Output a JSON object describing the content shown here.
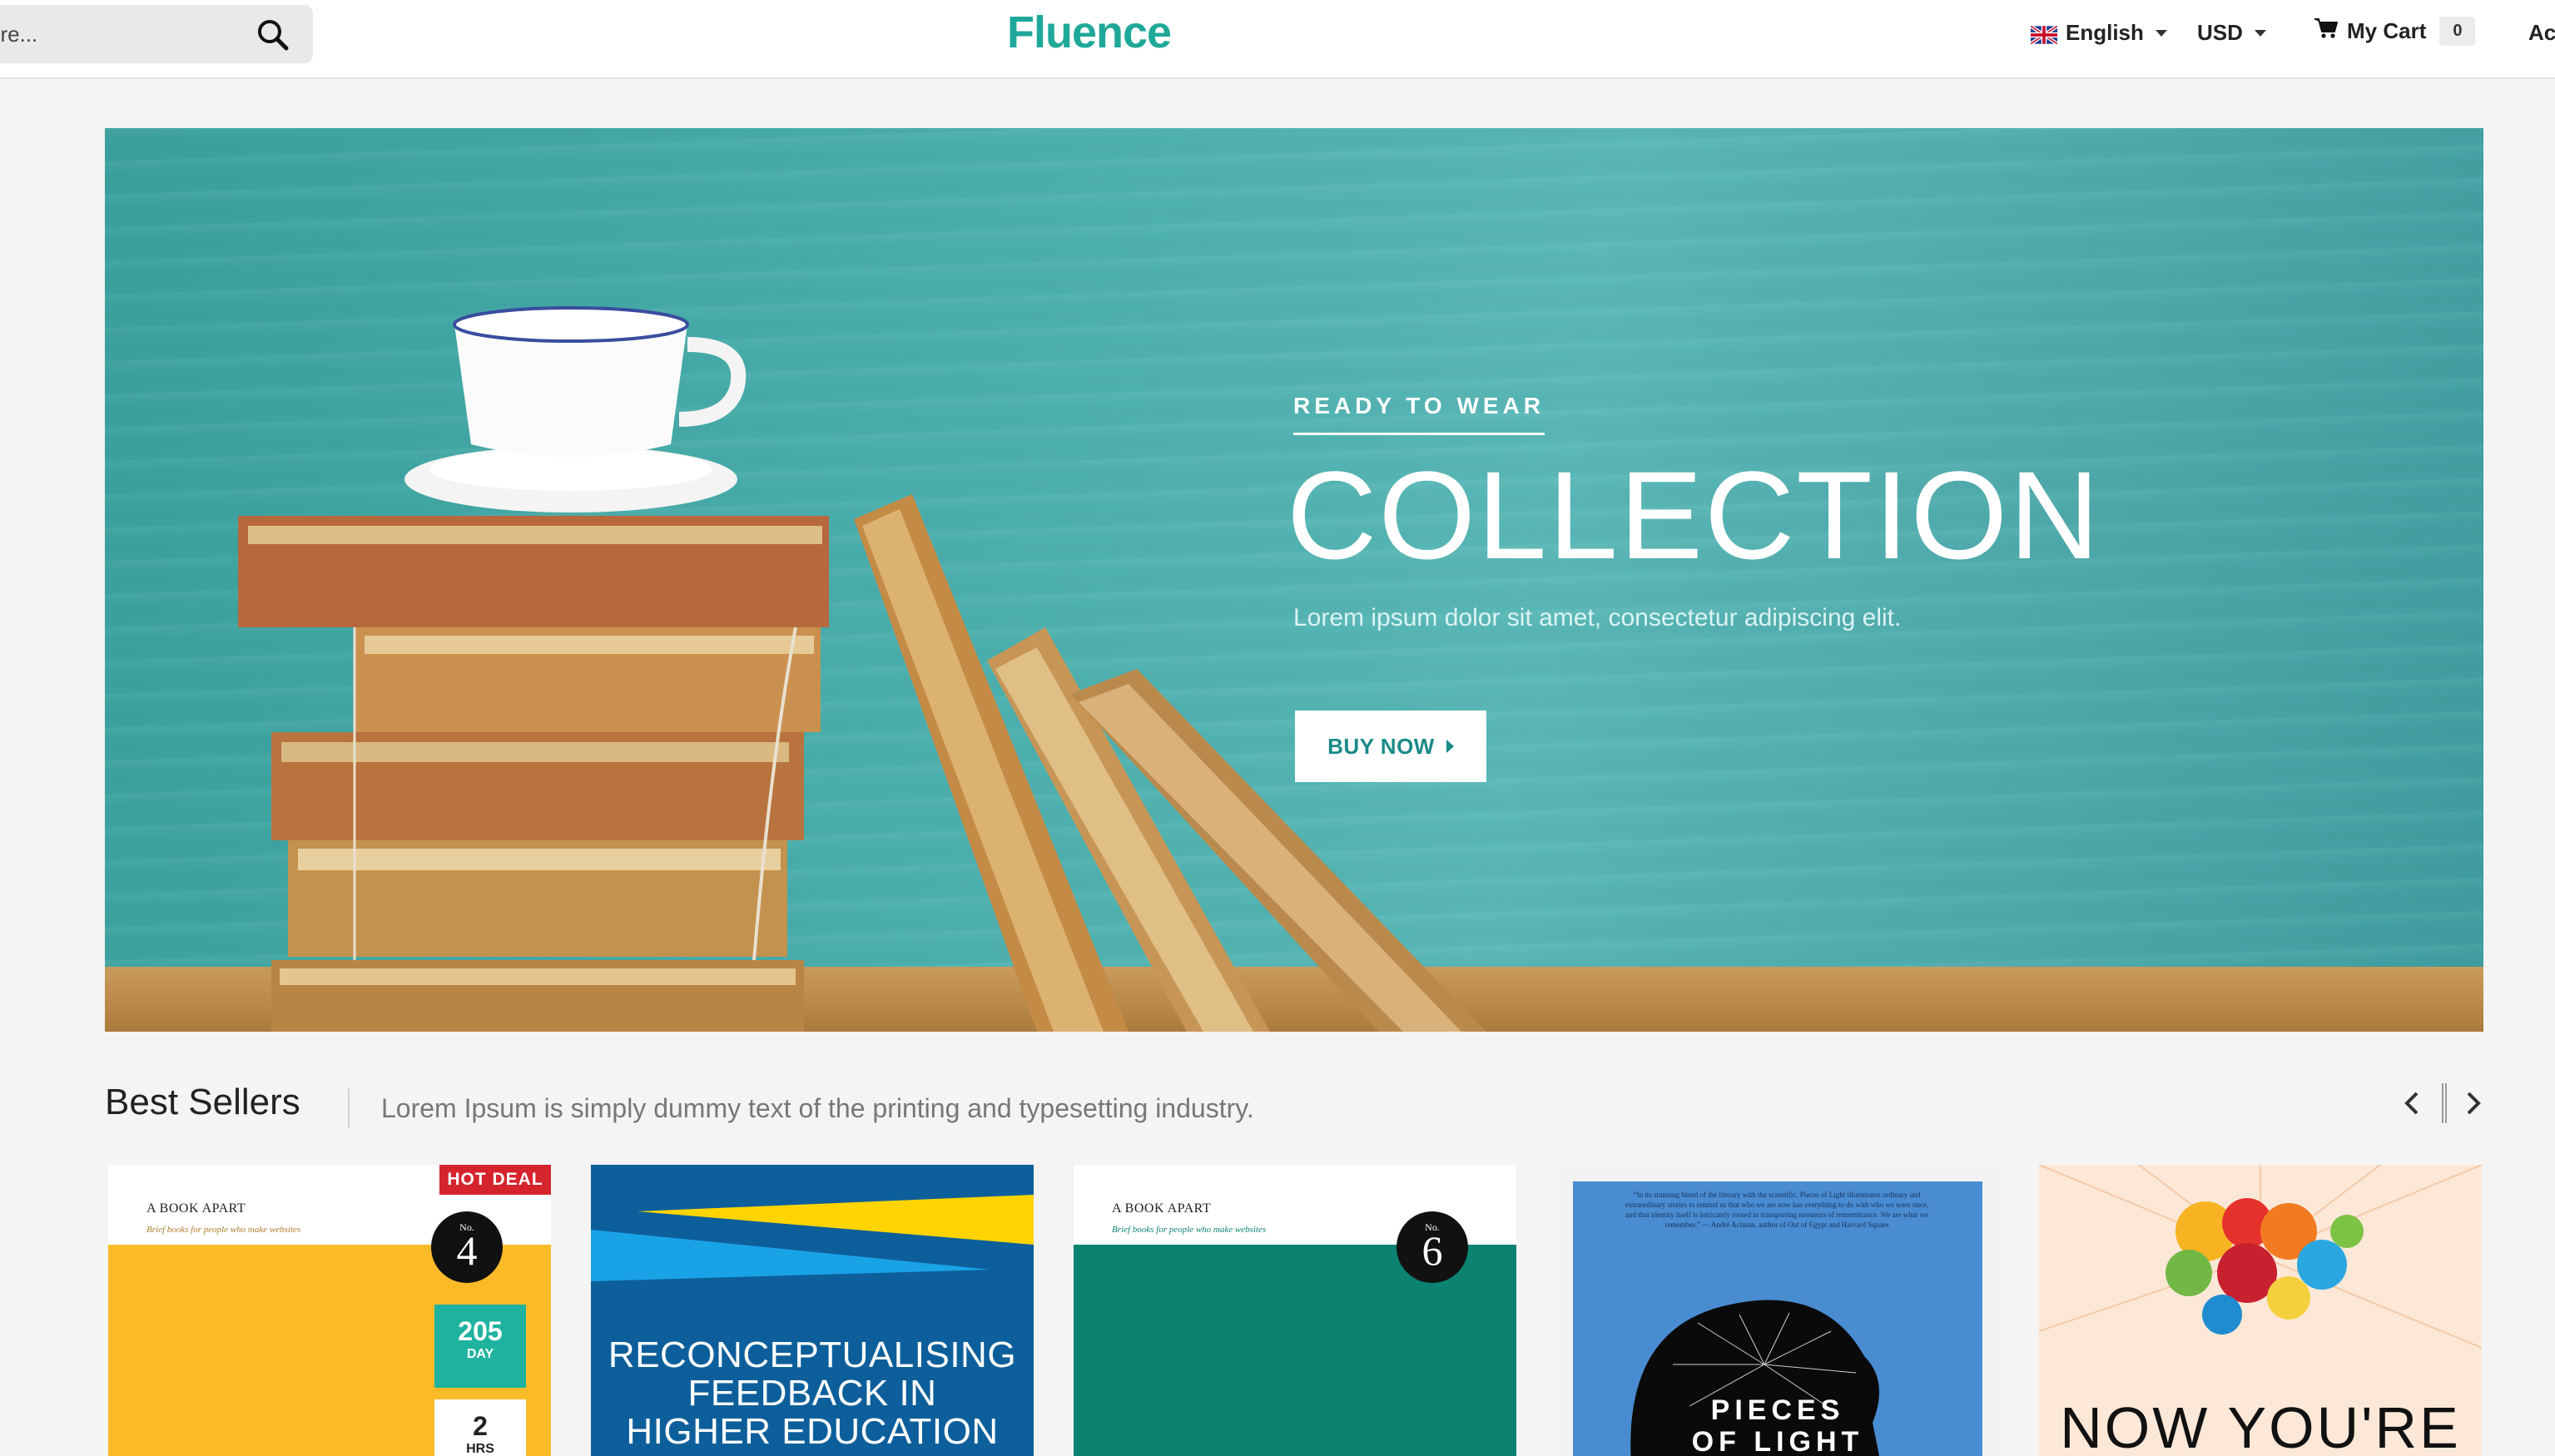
{
  "header": {
    "search_placeholder": "ere...",
    "logo": "Fluence",
    "language": "English",
    "currency": "USD",
    "cart_label": "My Cart",
    "cart_count": "0",
    "account_label": "Ac"
  },
  "hero": {
    "kicker": "READY TO WEAR",
    "title": "COLLECTION",
    "subtitle": "Lorem ipsum dolor sit amet, consectetur adipiscing elit.",
    "button": "BUY NOW"
  },
  "best_sellers": {
    "title": "Best Sellers",
    "description": "Lorem Ipsum is simply dummy text of the printing and typesetting industry.",
    "products": [
      {
        "publisher": "A BOOK APART",
        "publisher_tagline": "Brief books for people who make websites",
        "number_prefix": "No.",
        "number": "4",
        "badge": "HOT DEAL",
        "countdown": [
          {
            "value": "205",
            "unit": "DAY"
          },
          {
            "value": "2",
            "unit": "HRS"
          }
        ]
      },
      {
        "title_lines": [
          "RECONCEPTUALISING",
          "FEEDBACK IN",
          "HIGHER EDUCATION"
        ]
      },
      {
        "publisher": "A BOOK APART",
        "publisher_tagline": "Brief books for people who make websites",
        "number_prefix": "No.",
        "number": "6"
      },
      {
        "quote": "“In its stunning blend of the literary with the scientific, Pieces of Light illuminates ordinary and extraordinary stories to remind us that who we are now has everything to do with who we were once, and that identity itself is intricately rooted in transporting moments of remembrance. We are what we remember.” — André Aciman, author of Out of Egypt and Harvard Square",
        "title_lines": [
          "PIECES",
          "OF LIGHT"
        ]
      },
      {
        "title": "NOW YOU'RE"
      }
    ]
  },
  "colors": {
    "brand": "#1fa899",
    "hero_teal": "#4aaeac",
    "hot_deal": "#d6242d",
    "count_green": "#1fb39f"
  },
  "icons": [
    "search-icon",
    "uk-flag-icon",
    "caret-down-icon",
    "cart-icon",
    "arrow-right-icon",
    "chevron-left-icon",
    "chevron-right-icon"
  ]
}
